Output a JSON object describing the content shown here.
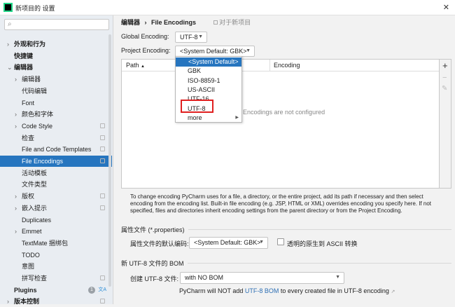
{
  "window": {
    "title": "新项目的 设置",
    "close": "✕"
  },
  "sidebar": {
    "search_placeholder": "",
    "items": [
      {
        "label": "外观和行为",
        "bold": true,
        "chevron": "›",
        "level": 0
      },
      {
        "label": "快捷键",
        "bold": true,
        "chevron": "",
        "level": 0
      },
      {
        "label": "编辑器",
        "bold": true,
        "chevron": "⌄",
        "level": 0
      },
      {
        "label": "编辑器",
        "chevron": "›",
        "level": 1
      },
      {
        "label": "代码编辑",
        "chevron": "",
        "level": 1
      },
      {
        "label": "Font",
        "chevron": "",
        "level": 1
      },
      {
        "label": "颜色和字体",
        "chevron": "›",
        "level": 1
      },
      {
        "label": "Code Style",
        "chevron": "›",
        "level": 1,
        "proj": true
      },
      {
        "label": "检查",
        "chevron": "",
        "level": 1,
        "proj": true
      },
      {
        "label": "File and Code Templates",
        "chevron": "",
        "level": 1,
        "proj": true
      },
      {
        "label": "File Encodings",
        "chevron": "",
        "level": 1,
        "proj": true,
        "selected": true
      },
      {
        "label": "活动模板",
        "chevron": "",
        "level": 1
      },
      {
        "label": "文件类型",
        "chevron": "",
        "level": 1
      },
      {
        "label": "版权",
        "chevron": "›",
        "level": 1,
        "proj": true
      },
      {
        "label": "嵌入提示",
        "chevron": "›",
        "level": 1,
        "proj": true
      },
      {
        "label": "Duplicates",
        "chevron": "",
        "level": 1
      },
      {
        "label": "Emmet",
        "chevron": "›",
        "level": 1
      },
      {
        "label": "TextMate 捆绑包",
        "chevron": "",
        "level": 1
      },
      {
        "label": "TODO",
        "chevron": "",
        "level": 1
      },
      {
        "label": "意图",
        "chevron": "",
        "level": 1
      },
      {
        "label": "拼写检查",
        "chevron": "",
        "level": 1,
        "proj": true
      },
      {
        "label": "Plugins",
        "bold": true,
        "chevron": "",
        "level": 0,
        "badge": "1"
      },
      {
        "label": "版本控制",
        "bold": true,
        "chevron": "›",
        "level": 0,
        "proj": true
      }
    ]
  },
  "breadcrumb": {
    "parent": "编辑器",
    "sep": "›",
    "current": "File Encodings",
    "scope": "对于新项目"
  },
  "global_encoding": {
    "label": "Global Encoding:",
    "value": "UTF-8"
  },
  "project_encoding": {
    "label": "Project Encoding:",
    "value": "<System Default: GBK>"
  },
  "table": {
    "columns": [
      "Path",
      "Encoding"
    ],
    "empty_text": "Encodings are not configured",
    "sort": "▲"
  },
  "toolbar": {
    "add": "+",
    "remove": "−",
    "edit": "✎"
  },
  "dropdown": {
    "options": [
      "<System Default>",
      "GBK",
      "ISO-8859-1",
      "US-ASCII",
      "UTF-16",
      "UTF-8",
      "more"
    ],
    "selected": "<System Default>",
    "highlighted": "UTF-8",
    "submenu_arrow": "▶"
  },
  "help_text": "To change encoding PyCharm uses for a file, a directory, or the entire project, add its path if necessary and then select encoding from the encoding list. Built-in file encoding (e.g. JSP, HTML or XML) overrides encoding you specify here. If not specified, files and directories inherit encoding settings from the parent directory or from the Project Encoding.",
  "properties": {
    "section": "属性文件 (*.properties)",
    "label": "属性文件的默认编码:",
    "value": "<System Default: GBK>",
    "checkbox_label": "透明的原生到 ASCII 转换",
    "checked": false
  },
  "bom": {
    "section": "新 UTF-8 文件的 BOM",
    "label": "创建 UTF-8 文件:",
    "value": "with NO BOM",
    "note_pre": "PyCharm will NOT add ",
    "note_link": "UTF-8 BOM",
    "note_post": " to every created file in UTF-8 encoding",
    "note_icon": "↗"
  },
  "colors": {
    "accent": "#2675bf",
    "highlight_box": "#e02020"
  }
}
